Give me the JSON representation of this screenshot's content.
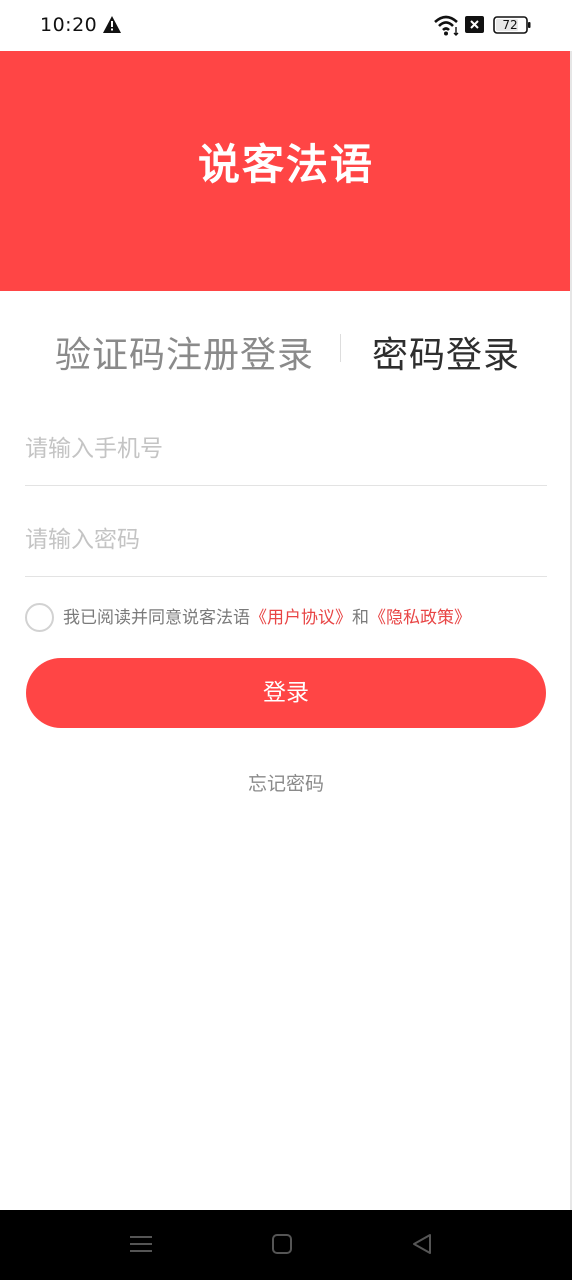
{
  "status_bar": {
    "time": "10:20",
    "battery": "72",
    "icons": [
      "warning-icon",
      "wifi-icon",
      "sim-off-icon",
      "battery-icon"
    ]
  },
  "header": {
    "title": "说客法语",
    "background_color": "#ff4545"
  },
  "tabs": [
    {
      "label": "验证码注册登录",
      "active": false
    },
    {
      "label": "密码登录",
      "active": true
    }
  ],
  "form": {
    "phone_placeholder": "请输入手机号",
    "password_placeholder": "请输入密码",
    "agreement_prefix": "我已阅读并同意说客法语",
    "user_agreement_link": "《用户协议》",
    "agreement_and": "和",
    "privacy_policy_link": "《隐私政策》",
    "login_button": "登录",
    "forgot_password": "忘记密码"
  },
  "nav_bar": {
    "icons": [
      "menu-icon",
      "home-icon",
      "back-icon"
    ]
  },
  "colors": {
    "accent": "#ff4545",
    "link": "#e84545"
  }
}
